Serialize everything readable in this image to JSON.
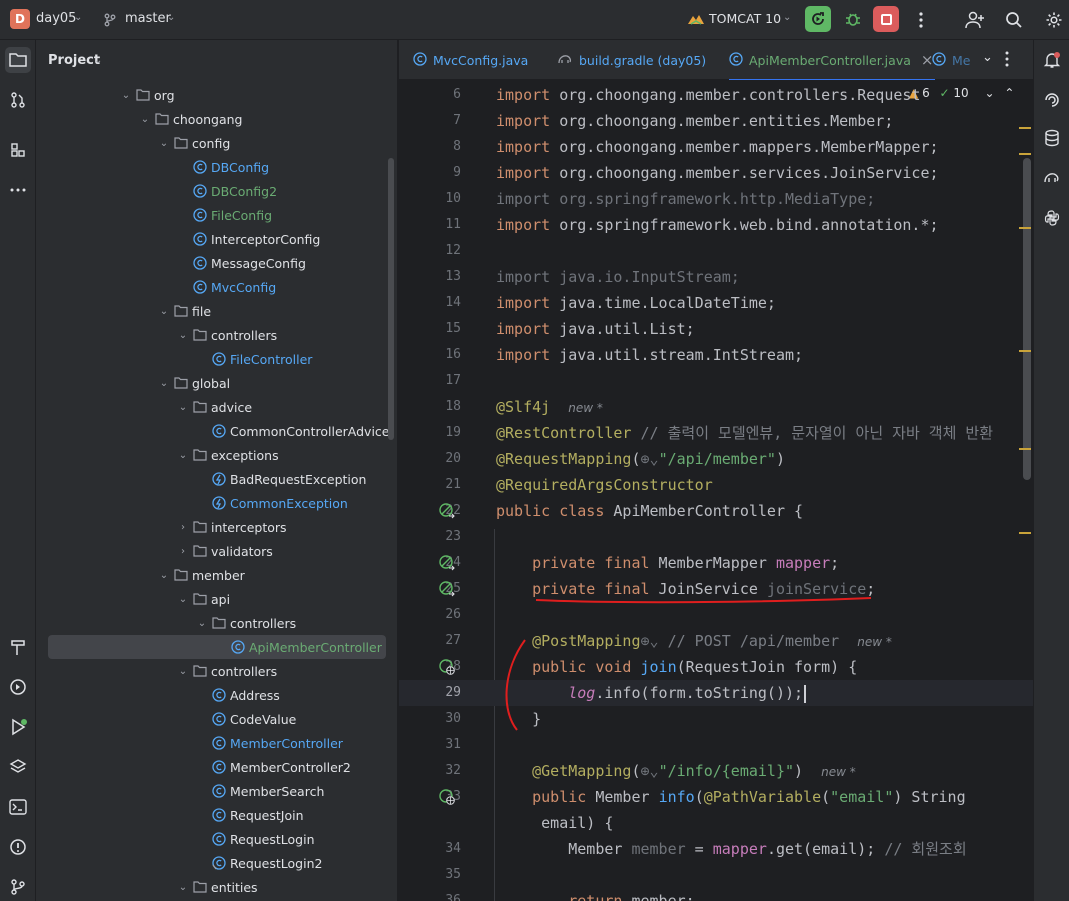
{
  "topbar": {
    "project_badge": "D",
    "project_name": "day05",
    "branch": "master",
    "run_config": "TOMCAT 10"
  },
  "project_panel": {
    "title": "Project",
    "tree": [
      {
        "label": "org",
        "type": "folder",
        "depth": 0,
        "arrow": "v"
      },
      {
        "label": "choongang",
        "type": "folder",
        "depth": 1,
        "arrow": "v"
      },
      {
        "label": "config",
        "type": "folder",
        "depth": 2,
        "arrow": "v"
      },
      {
        "label": "DBConfig",
        "type": "class",
        "depth": 3,
        "arrow": "",
        "color": "#56a8f5"
      },
      {
        "label": "DBConfig2",
        "type": "class",
        "depth": 3,
        "arrow": "",
        "color": "#6aab73"
      },
      {
        "label": "FileConfig",
        "type": "class",
        "depth": 3,
        "arrow": "",
        "color": "#6aab73"
      },
      {
        "label": "InterceptorConfig",
        "type": "class",
        "depth": 3,
        "arrow": "",
        "color": "#dfe1e5"
      },
      {
        "label": "MessageConfig",
        "type": "class",
        "depth": 3,
        "arrow": "",
        "color": "#dfe1e5"
      },
      {
        "label": "MvcConfig",
        "type": "class",
        "depth": 3,
        "arrow": "",
        "color": "#56a8f5"
      },
      {
        "label": "file",
        "type": "folder",
        "depth": 2,
        "arrow": "v"
      },
      {
        "label": "controllers",
        "type": "folder",
        "depth": 3,
        "arrow": "v"
      },
      {
        "label": "FileController",
        "type": "class",
        "depth": 4,
        "arrow": "",
        "color": "#56a8f5"
      },
      {
        "label": "global",
        "type": "folder",
        "depth": 2,
        "arrow": "v"
      },
      {
        "label": "advice",
        "type": "folder",
        "depth": 3,
        "arrow": "v"
      },
      {
        "label": "CommonControllerAdvice",
        "type": "class",
        "depth": 4,
        "arrow": "",
        "color": "#dfe1e5"
      },
      {
        "label": "exceptions",
        "type": "folder",
        "depth": 3,
        "arrow": "v"
      },
      {
        "label": "BadRequestException",
        "type": "exception",
        "depth": 4,
        "arrow": "",
        "color": "#dfe1e5"
      },
      {
        "label": "CommonException",
        "type": "exception",
        "depth": 4,
        "arrow": "",
        "color": "#56a8f5"
      },
      {
        "label": "interceptors",
        "type": "folder",
        "depth": 3,
        "arrow": ">"
      },
      {
        "label": "validators",
        "type": "folder",
        "depth": 3,
        "arrow": ">"
      },
      {
        "label": "member",
        "type": "folder",
        "depth": 2,
        "arrow": "v"
      },
      {
        "label": "api",
        "type": "folder",
        "depth": 3,
        "arrow": "v"
      },
      {
        "label": "controllers",
        "type": "folder",
        "depth": 4,
        "arrow": "v"
      },
      {
        "label": "ApiMemberController",
        "type": "class",
        "depth": 5,
        "arrow": "",
        "color": "#6aab73",
        "selected": true
      },
      {
        "label": "controllers",
        "type": "folder",
        "depth": 3,
        "arrow": "v"
      },
      {
        "label": "Address",
        "type": "class",
        "depth": 4,
        "arrow": "",
        "color": "#dfe1e5"
      },
      {
        "label": "CodeValue",
        "type": "class",
        "depth": 4,
        "arrow": "",
        "color": "#dfe1e5"
      },
      {
        "label": "MemberController",
        "type": "class",
        "depth": 4,
        "arrow": "",
        "color": "#56a8f5"
      },
      {
        "label": "MemberController2",
        "type": "class",
        "depth": 4,
        "arrow": "",
        "color": "#dfe1e5"
      },
      {
        "label": "MemberSearch",
        "type": "class",
        "depth": 4,
        "arrow": "",
        "color": "#dfe1e5"
      },
      {
        "label": "RequestJoin",
        "type": "class",
        "depth": 4,
        "arrow": "",
        "color": "#dfe1e5"
      },
      {
        "label": "RequestLogin",
        "type": "class",
        "depth": 4,
        "arrow": "",
        "color": "#dfe1e5"
      },
      {
        "label": "RequestLogin2",
        "type": "class-old",
        "depth": 4,
        "arrow": "",
        "color": "#dfe1e5"
      },
      {
        "label": "entities",
        "type": "folder",
        "depth": 3,
        "arrow": "v"
      }
    ]
  },
  "tabs": [
    {
      "label": "MvcConfig.java",
      "color": "#56a8f5",
      "active": false
    },
    {
      "label": "build.gradle (day05)",
      "color": "#56a8f5",
      "active": false
    },
    {
      "label": "ApiMemberController.java",
      "color": "#6aab73",
      "active": true,
      "close": "×"
    },
    {
      "label": "Me",
      "color": "#56a8f5",
      "active": false
    }
  ],
  "inspections": {
    "warnings": "6",
    "ok": "10"
  },
  "editor": {
    "current_line": "29",
    "lines": [
      {
        "n": "6",
        "html": "<span class=\"kw\">import</span> org.choongang.member.controllers.Request"
      },
      {
        "n": "7",
        "html": "<span class=\"kw\">import</span> org.choongang.member.entities.Member;"
      },
      {
        "n": "8",
        "html": "<span class=\"kw\">import</span> org.choongang.member.mappers.MemberMapper;"
      },
      {
        "n": "9",
        "html": "<span class=\"kw\">import</span> org.choongang.member.services.JoinService;"
      },
      {
        "n": "10",
        "html": "<span class=\"dim\">import org.springframework.http.MediaType;</span>"
      },
      {
        "n": "11",
        "html": "<span class=\"kw\">import</span> org.springframework.web.bind.annotation.*;"
      },
      {
        "n": "12",
        "html": ""
      },
      {
        "n": "13",
        "html": "<span class=\"dim\">import java.io.InputStream;</span>"
      },
      {
        "n": "14",
        "html": "<span class=\"kw\">import</span> java.time.LocalDateTime;"
      },
      {
        "n": "15",
        "html": "<span class=\"kw\">import</span> java.util.List;"
      },
      {
        "n": "16",
        "html": "<span class=\"kw\">import</span> java.util.stream.IntStream;"
      },
      {
        "n": "17",
        "html": ""
      },
      {
        "n": "18",
        "html": "<span class=\"ann\">@Slf4j</span>  <span class=\"hint\">new *</span>"
      },
      {
        "n": "19",
        "html": "<span class=\"ann\">@RestController</span> <span class=\"cmt\">// 출력이 모델엔뷰, 문자열이 아닌 자바 객체 반환</span>"
      },
      {
        "n": "20",
        "html": "<span class=\"ann\">@RequestMapping</span>(<span class=\"dim\">⊕⌄</span><span class=\"str\">\"/api/member\"</span>)"
      },
      {
        "n": "21",
        "html": "<span class=\"ann\">@RequiredArgsConstructor</span>"
      },
      {
        "n": "22",
        "html": "<span class=\"kw\">public class</span> ApiMemberController {"
      },
      {
        "n": "23",
        "html": ""
      },
      {
        "n": "24",
        "html": "    <span class=\"kw\">private final</span> MemberMapper <span class=\"fld\">mapper</span>;"
      },
      {
        "n": "25",
        "html": "    <span class=\"kw\">private final</span> JoinService <span class=\"dim\">joinService</span>;"
      },
      {
        "n": "26",
        "html": ""
      },
      {
        "n": "27",
        "html": "    <span class=\"ann\">@PostMapping</span><span class=\"dim\">⊕⌄</span> <span class=\"cmt\">// POST /api/member</span>  <span class=\"hint\">new *</span>"
      },
      {
        "n": "28",
        "html": "    <span class=\"kw\">public void</span> <span class=\"fn\">join</span>(RequestJoin form) {"
      },
      {
        "n": "29",
        "html": "        <span class=\"fld ital\">log</span>.info(form.toString());"
      },
      {
        "n": "30",
        "html": "    }"
      },
      {
        "n": "31",
        "html": ""
      },
      {
        "n": "32",
        "html": "    <span class=\"ann\">@GetMapping</span>(<span class=\"dim\">⊕⌄</span><span class=\"str\">\"/info/{email}\"</span>)  <span class=\"hint\">new *</span>"
      },
      {
        "n": "33",
        "html": "    <span class=\"kw\">public</span> Member <span class=\"fn\">info</span>(<span class=\"ann\">@PathVariable</span>(<span class=\"str\">\"email\"</span>) String"
      },
      {
        "n": "",
        "html": "     email) {"
      },
      {
        "n": "34",
        "html": "        Member <span class=\"dim\">member</span> = <span class=\"fld\">mapper</span>.get(email); <span class=\"cmt\">// 회원조회</span>"
      },
      {
        "n": "35",
        "html": ""
      },
      {
        "n": "36",
        "html": "        <span class=\"kw\">return</span> member;"
      }
    ]
  }
}
